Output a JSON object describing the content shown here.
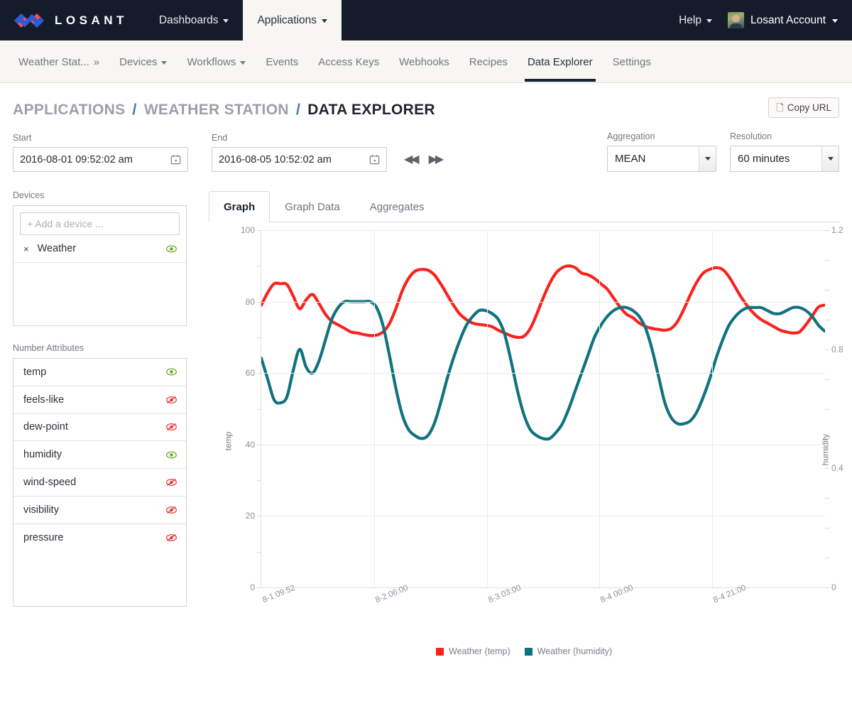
{
  "topnav": {
    "brand": "LOSANT",
    "logo_icon": "losant-diamond-logo",
    "items": [
      {
        "label": "Dashboards",
        "icon": "chevron-down-icon",
        "active": false
      },
      {
        "label": "Applications",
        "icon": "chevron-down-icon",
        "active": true
      }
    ],
    "help": {
      "label": "Help",
      "icon": "chevron-down-icon"
    },
    "account": {
      "label": "Losant Account",
      "icon": "chevron-down-icon",
      "avatar": "user-avatar"
    }
  },
  "subnav": {
    "items": [
      {
        "label": "Weather Stat...",
        "suffix": "»",
        "active": false
      },
      {
        "label": "Devices",
        "caret": true,
        "active": false
      },
      {
        "label": "Workflows",
        "caret": true,
        "active": false
      },
      {
        "label": "Events",
        "active": false
      },
      {
        "label": "Access Keys",
        "active": false
      },
      {
        "label": "Webhooks",
        "active": false
      },
      {
        "label": "Recipes",
        "active": false
      },
      {
        "label": "Data Explorer",
        "active": true
      },
      {
        "label": "Settings",
        "active": false
      }
    ]
  },
  "breadcrumb": {
    "applications": "APPLICATIONS",
    "sep1": "/",
    "station": "WEATHER STATION",
    "sep2": "/",
    "current": "DATA EXPLORER"
  },
  "copy_url": {
    "label": "Copy URL",
    "icon": "copy-icon"
  },
  "controls": {
    "start": {
      "label": "Start",
      "value": "2016-08-01 09:52:02 am",
      "icon": "calendar-icon"
    },
    "end": {
      "label": "End",
      "value": "2016-08-05 10:52:02 am",
      "icon": "calendar-icon"
    },
    "prev_icon": "double-left-arrow-icon",
    "next_icon": "double-right-arrow-icon",
    "aggregation": {
      "label": "Aggregation",
      "value": "MEAN"
    },
    "resolution": {
      "label": "Resolution",
      "value": "60 minutes"
    }
  },
  "sidebar": {
    "devices_label": "Devices",
    "device_input_placeholder": "+ Add a device ...",
    "devices": [
      {
        "name": "Weather",
        "remove": "×",
        "visible": true
      }
    ],
    "attributes_label": "Number Attributes",
    "attributes": [
      {
        "name": "temp",
        "visible": true
      },
      {
        "name": "feels-like",
        "visible": false
      },
      {
        "name": "dew-point",
        "visible": false
      },
      {
        "name": "humidity",
        "visible": true
      },
      {
        "name": "wind-speed",
        "visible": false
      },
      {
        "name": "visibility",
        "visible": false
      },
      {
        "name": "pressure",
        "visible": false
      }
    ]
  },
  "tabs": [
    {
      "label": "Graph",
      "active": true
    },
    {
      "label": "Graph Data",
      "active": false
    },
    {
      "label": "Aggregates",
      "active": false
    }
  ],
  "colors": {
    "temp": "#f8231f",
    "humidity": "#11727f",
    "navbar": "#141c2b",
    "accent": "#4a6fbf",
    "eye_on": "#6aa521",
    "eye_off": "#e33a3a"
  },
  "chart_data": {
    "type": "line",
    "title": "",
    "xlabel": "",
    "ylabel": "temp",
    "y2label": "humidity",
    "ylim": [
      0,
      100
    ],
    "y2lim": [
      0,
      1.2
    ],
    "yticks": [
      0,
      20,
      40,
      60,
      80,
      100
    ],
    "y2ticks": [
      0,
      0.4,
      0.8,
      1.2
    ],
    "xticks": [
      "8-1 09:52",
      "8-2 06:00",
      "8-3 03:00",
      "8-4 00:00",
      "8-4 21:00"
    ],
    "grid": true,
    "legend_position": "bottom",
    "series": [
      {
        "name": "Weather (temp)",
        "color": "#f8231f",
        "axis": "left",
        "values": [
          79.0,
          82.5,
          85.0,
          85.0,
          84.8,
          81.5,
          78.0,
          80.5,
          82.0,
          79.5,
          76.5,
          74.5,
          73.5,
          72.5,
          71.5,
          71.2,
          70.8,
          70.5,
          70.6,
          71.5,
          73.8,
          78.0,
          83.0,
          86.5,
          88.5,
          89.0,
          88.8,
          87.5,
          85.0,
          82.0,
          79.0,
          76.5,
          75.0,
          74.0,
          73.6,
          73.4,
          73.0,
          72.0,
          71.2,
          70.4,
          70.0,
          70.3,
          72.5,
          76.5,
          81.0,
          85.0,
          88.0,
          89.5,
          90.0,
          89.5,
          88.0,
          87.5,
          86.5,
          85.0,
          83.5,
          81.0,
          78.5,
          76.5,
          75.5,
          74.0,
          73.0,
          72.5,
          72.2,
          72.0,
          72.5,
          74.5,
          78.0,
          82.0,
          85.5,
          88.0,
          89.0,
          89.5,
          89.0,
          87.0,
          84.0,
          81.0,
          78.5,
          76.5,
          75.0,
          74.0,
          73.0,
          72.0,
          71.5,
          71.2,
          71.5,
          73.5,
          76.0,
          78.5,
          79.0
        ]
      },
      {
        "name": "Weather (humidity)",
        "color": "#11727f",
        "axis": "right",
        "values": [
          0.77,
          0.7,
          0.63,
          0.62,
          0.64,
          0.73,
          0.8,
          0.74,
          0.72,
          0.76,
          0.83,
          0.9,
          0.94,
          0.96,
          0.96,
          0.96,
          0.96,
          0.96,
          0.94,
          0.88,
          0.78,
          0.67,
          0.58,
          0.53,
          0.51,
          0.5,
          0.51,
          0.55,
          0.62,
          0.7,
          0.77,
          0.83,
          0.88,
          0.91,
          0.93,
          0.93,
          0.92,
          0.9,
          0.85,
          0.76,
          0.66,
          0.58,
          0.53,
          0.51,
          0.5,
          0.5,
          0.52,
          0.55,
          0.6,
          0.66,
          0.72,
          0.78,
          0.84,
          0.88,
          0.91,
          0.93,
          0.94,
          0.94,
          0.93,
          0.91,
          0.87,
          0.8,
          0.71,
          0.62,
          0.57,
          0.55,
          0.55,
          0.56,
          0.59,
          0.64,
          0.7,
          0.77,
          0.83,
          0.88,
          0.91,
          0.93,
          0.94,
          0.94,
          0.94,
          0.93,
          0.92,
          0.92,
          0.93,
          0.94,
          0.94,
          0.93,
          0.91,
          0.88,
          0.86
        ]
      }
    ]
  }
}
